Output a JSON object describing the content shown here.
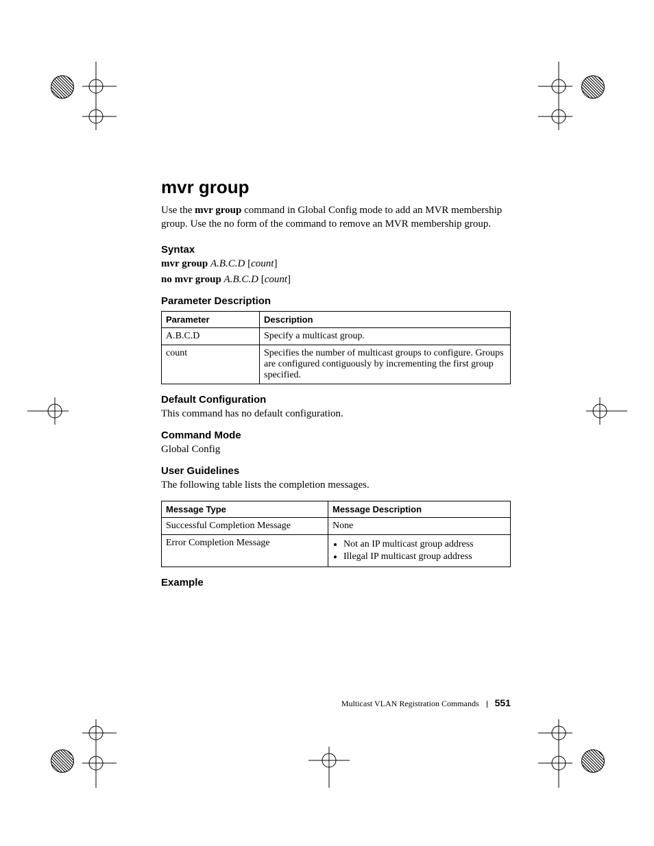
{
  "title": "mvr group",
  "intro_parts": {
    "p1a": "Use the ",
    "p1b": "mvr group",
    "p1c": " command in Global Config mode to add an MVR membership group. Use the no form of the command to remove an MVR membership group."
  },
  "sections": {
    "syntax": "Syntax",
    "param_desc": "Parameter Description",
    "default_cfg": "Default Configuration",
    "cmd_mode": "Command Mode",
    "user_guidelines": "User Guidelines",
    "example": "Example"
  },
  "syntax_lines": {
    "l1": {
      "cmd": "mvr group ",
      "arg1": "A.B.C.D",
      "lb": " [",
      "arg2": "count",
      "rb": "]"
    },
    "l2": {
      "cmd": "no mvr group ",
      "arg1": "A.B.C.D",
      "lb": " [",
      "arg2": "count",
      "rb": "]"
    }
  },
  "param_table": {
    "headers": {
      "c1": "Parameter",
      "c2": "Description"
    },
    "rows": [
      {
        "c1": "A.B.C.D",
        "c2": "Specify a multicast group."
      },
      {
        "c1": "count",
        "c2": "Specifies the number of multicast groups to configure. Groups are configured contiguously by incrementing the first group specified."
      }
    ]
  },
  "default_cfg_text": "This command has no default configuration.",
  "cmd_mode_text": "Global Config",
  "user_guidelines_text": "The following table lists the completion messages.",
  "msg_table": {
    "headers": {
      "c1": "Message Type",
      "c2": "Message Description"
    },
    "rows": {
      "r1": {
        "c1": "Successful Completion Message",
        "c2": "None"
      },
      "r2": {
        "c1": "Error Completion Message",
        "bullets": [
          "Not an IP multicast group address",
          "Illegal IP multicast group address"
        ]
      }
    }
  },
  "footer": {
    "chapter": "Multicast VLAN Registration Commands",
    "page": "551"
  }
}
